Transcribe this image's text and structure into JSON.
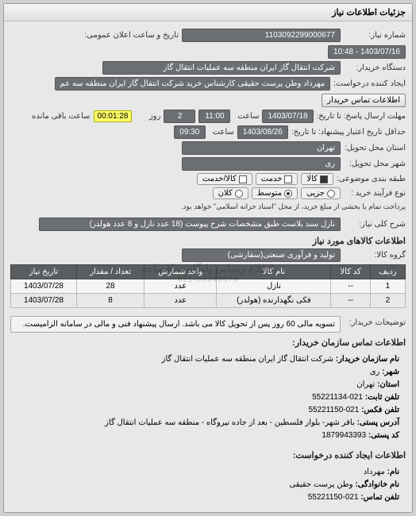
{
  "header": {
    "title": "جزئیات اطلاعات نیاز"
  },
  "fields": {
    "shomare_label": "شماره نیاز:",
    "shomare": "1103092299000677",
    "datetime_label": "تاریخ و ساعت اعلان عمومی:",
    "datetime": "1403/07/16 - 10:48",
    "buyer_label": "دستگاه خریدار:",
    "buyer": "شرکت انتقال گاز ایران منطقه سه عملیات انتقال گاز",
    "creator_label": "ایجاد کننده درخواست:",
    "creator": "مهرداد وطن پرست حقیقی کارشناس خرید شرکت انتقال گاز ایران منطقه سه عم",
    "btn_contact": "اطلاعات تماس خریدار",
    "deadline_label": "مهلت ارسال پاسخ: تا تاریخ:",
    "deadline_date": "1403/07/18",
    "saat_label": "ساعت",
    "deadline_time": "11:00",
    "days_label": "روز",
    "days": "2",
    "remain_label": "ساعت باقی مانده",
    "remain_time": "00:01:28",
    "etebar_label": "حداقل تاریخ اعتبار پیشنهاد: تا تاریخ:",
    "etebar_date": "1403/08/26",
    "etebar_time": "09:30",
    "ostan_label": "استان محل تحویل:",
    "ostan": "تهران",
    "shahr_label": "شهر محل تحویل:",
    "shahr": "ری",
    "budget_label": "طبقه بندی موضوعی:",
    "b1": "کالا",
    "b2": "خدمت",
    "b3": "کالا/خدمت",
    "type_label": "نوع فرآیند خرید :",
    "t1": "جزیی",
    "t2": "متوسط",
    "t3": "کلان",
    "type_note": "پرداخت تمام یا بخشی از مبلغ خرید، از محل \"اسناد خزانه اسلامی\" خواهد بود.",
    "desc_label": "شرح کلی نیاز:",
    "desc": "نازل سند بلاست طبق مشخصات شرح پیوست (18 عدد نازل و 8 عدد هولدر)",
    "goods_title": "اطلاعات کالاهای مورد نیاز",
    "group_label": "گروه کالا:",
    "group": "تولید و فرآوری صنعتی(سفارشی)"
  },
  "table": {
    "headers": [
      "ردیف",
      "کد کالا",
      "نام کالا",
      "واحد شمارش",
      "تعداد / مقدار",
      "تاریخ نیاز"
    ],
    "rows": [
      [
        "1",
        "--",
        "نازل",
        "عدد",
        "28",
        "1403/07/28"
      ],
      [
        "2",
        "--",
        "فکی نگهدارنده (هولدر)",
        "عدد",
        "8",
        "1403/07/28"
      ]
    ]
  },
  "buyer_note": {
    "label": "توضیحات خریدار:",
    "text": "تسویه مالی 60 روز پس از تحویل کالا می باشد. ارسال پیشنهاد فنی و مالی در سامانه الزامیست."
  },
  "contact1": {
    "title": "اطلاعات تماس سازمان خریدار:",
    "org_k": "نام سازمان خریدار:",
    "org": "شرکت انتقال گاز ایران منطقه سه عملیات انتقال گاز",
    "city_k": "شهر:",
    "city": "ری",
    "prov_k": "استان:",
    "prov": "تهران",
    "tel_k": "تلفن ثابت:",
    "tel": "021-55221134",
    "fax_k": "تلفن فکس:",
    "fax": "021-55221150",
    "addr_k": "آدرس پستی:",
    "addr": "باقر شهر- بلوار فلسطین - بعد از جاده نیروگاه - منطقه سه عملیات انتقال گاز",
    "post_k": "کد پستی:",
    "post": "1879943393"
  },
  "contact2": {
    "title": "اطلاعات ایجاد کننده درخواست:",
    "name_k": "نام:",
    "name": "مهرداد",
    "fam_k": "نام خانوادگی:",
    "fam": "وطن پرست حقیقی",
    "tel_k": "تلفن تماس:",
    "tel": "021-55221150"
  },
  "watermark": {
    "main": "اطلاع رسانی پایگاه مناقصات",
    "sub": "021-88349670"
  }
}
